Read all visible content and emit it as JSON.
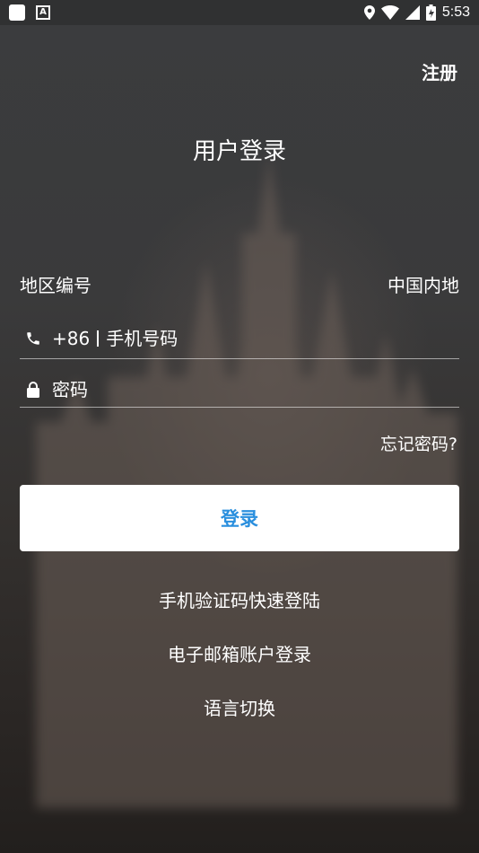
{
  "status_bar": {
    "time": "5:53"
  },
  "header": {
    "register_label": "注册",
    "title": "用户登录"
  },
  "region": {
    "label": "地区编号",
    "value": "中国内地"
  },
  "phone": {
    "country_code": "+86",
    "placeholder": "手机号码"
  },
  "password": {
    "placeholder": "密码"
  },
  "forgot_label": "忘记密码?",
  "login_label": "登录",
  "alt_options": {
    "sms_login": "手机验证码快速登陆",
    "email_login": "电子邮箱账户登录",
    "language": "语言切换"
  },
  "colors": {
    "accent": "#2a8fde",
    "button_bg": "#ffffff"
  }
}
